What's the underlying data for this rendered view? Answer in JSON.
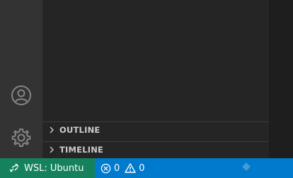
{
  "activity_bar": {
    "icons": [
      "account-icon",
      "settings-gear-icon"
    ]
  },
  "sidebar": {
    "sections": [
      {
        "label": "OUTLINE"
      },
      {
        "label": "TIMELINE"
      }
    ]
  },
  "statusbar": {
    "remote_label": "WSL: Ubuntu",
    "errors_count": "0",
    "warnings_count": "0"
  },
  "colors": {
    "activity_bar_bg": "#333333",
    "sidebar_bg": "#252526",
    "editor_bg": "#1e1e1e",
    "statusbar_bg": "#007acc",
    "remote_bg": "#16825d"
  }
}
